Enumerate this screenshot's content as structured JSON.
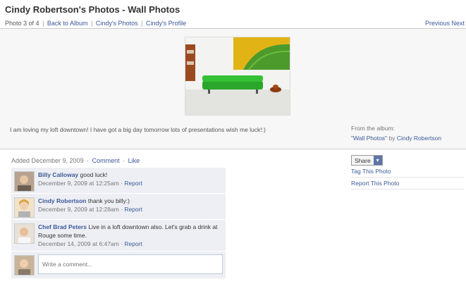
{
  "page": {
    "title": "Cindy Robertson's Photos - Wall Photos"
  },
  "nav": {
    "photo_counter": "Photo 3 of 4",
    "links": [
      "Back to Album",
      "Cindy's Photos",
      "Cindy's Profile"
    ],
    "previous": "Previous",
    "next": "Next"
  },
  "photo": {
    "caption": "I am loving my loft downtown! I have got a big day tomorrow lots of presentations wish me luck!:)",
    "album_prefix": "From the album:",
    "album_name": "\"Wall Photos\"",
    "album_by": "by",
    "album_owner": "Cindy Robertson"
  },
  "meta": {
    "added": "Added December 9, 2009",
    "comment": "Comment",
    "like": "Like"
  },
  "comments": [
    {
      "name": "Billy Calloway",
      "text": "good luck!",
      "time": "December 9, 2009 at 12:25am",
      "report": "Report"
    },
    {
      "name": "Cindy Robertson",
      "text": "thank you billy:)",
      "time": "December 9, 2009 at 12:28am",
      "report": "Report"
    },
    {
      "name": "Chef Brad Peters",
      "text": "Live in a loft downtown also. Let's grab a drink at Rouge some time.",
      "time": "December 14, 2009 at 6:47am",
      "report": "Report"
    }
  ],
  "composer": {
    "placeholder": "Write a comment..."
  },
  "sidebar": {
    "share": "Share",
    "tag": "Tag This Photo",
    "report": "Report This Photo"
  },
  "colors": {
    "link": "#3b5998",
    "comment_bg": "#edeff4",
    "sofa": "#2aa72a"
  }
}
